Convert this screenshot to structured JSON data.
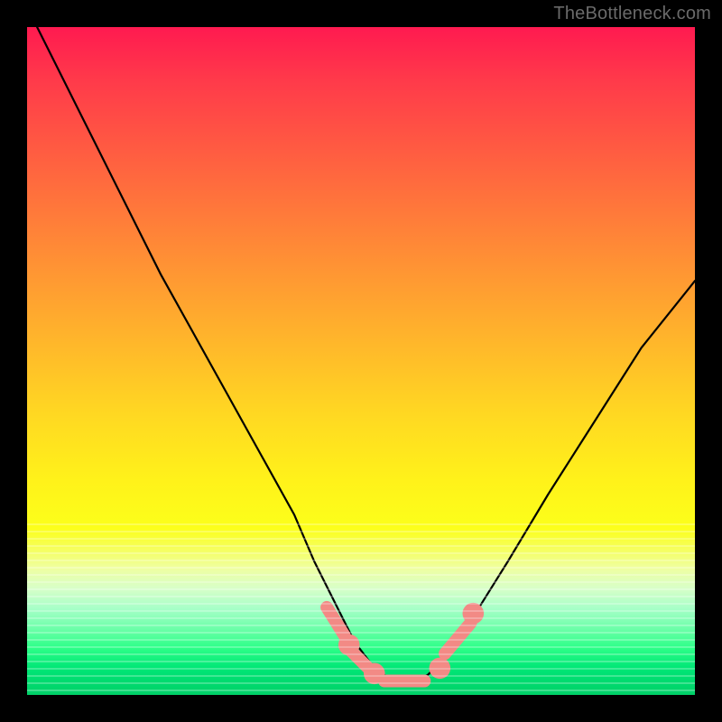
{
  "watermark": "TheBottleneck.com",
  "chart_data": {
    "type": "line",
    "title": "",
    "xlabel": "",
    "ylabel": "",
    "xlim": [
      0,
      100
    ],
    "ylim": [
      0,
      100
    ],
    "grid": false,
    "legend": false,
    "series": [
      {
        "name": "bottleneck-curve",
        "x": [
          0,
          5,
          10,
          15,
          20,
          25,
          30,
          35,
          40,
          43,
          46,
          49,
          52,
          55,
          58,
          60,
          63,
          67,
          72,
          78,
          85,
          92,
          100
        ],
        "y": [
          103,
          93,
          83,
          73,
          63,
          54,
          45,
          36,
          27,
          20,
          14,
          8,
          4,
          2,
          2,
          3,
          6,
          12,
          20,
          30,
          41,
          52,
          62
        ]
      }
    ],
    "markers": [
      {
        "shape": "capsule",
        "x": 46.2,
        "y": 11.0,
        "len": 5,
        "angle": -58
      },
      {
        "shape": "circle",
        "x": 48.2,
        "y": 7.5,
        "r": 1.6
      },
      {
        "shape": "capsule",
        "x": 49.8,
        "y": 5.3,
        "len": 4,
        "angle": -45
      },
      {
        "shape": "circle",
        "x": 52.0,
        "y": 3.2,
        "r": 1.6
      },
      {
        "shape": "bar",
        "x1": 53.5,
        "x2": 59.5,
        "y": 2.1
      },
      {
        "shape": "circle",
        "x": 61.8,
        "y": 4.0,
        "r": 1.6
      },
      {
        "shape": "capsule",
        "x": 64.5,
        "y": 8.5,
        "len": 6,
        "angle": 50
      },
      {
        "shape": "circle",
        "x": 66.8,
        "y": 12.2,
        "r": 1.6
      }
    ],
    "colors": {
      "curve": "#000000",
      "marker": "#f28a85",
      "gradient_top": "#ff1a50",
      "gradient_bottom": "#00d068"
    }
  }
}
